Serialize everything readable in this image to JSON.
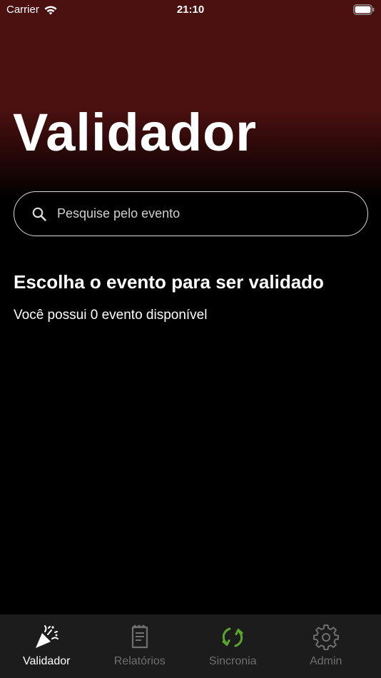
{
  "status_bar": {
    "carrier": "Carrier",
    "time": "21:10"
  },
  "header": {
    "title": "Validador"
  },
  "search": {
    "placeholder": "Pesquise pelo evento",
    "value": ""
  },
  "main": {
    "heading": "Escolha o evento para ser validado",
    "subtitle": "Você possui 0 evento disponível"
  },
  "tab_bar": {
    "tabs": [
      {
        "label": "Validador",
        "icon": "party-popper-icon",
        "active": true
      },
      {
        "label": "Relatórios",
        "icon": "receipt-icon",
        "active": false
      },
      {
        "label": "Sincronia",
        "icon": "sync-icon",
        "active": false
      },
      {
        "label": "Admin",
        "icon": "gear-icon",
        "active": false
      }
    ]
  },
  "colors": {
    "header_top": "#4b1010",
    "background": "#000000",
    "tab_bar": "#1c1c1c",
    "sync_accent": "#5aa728",
    "inactive_tab": "#6f6f6f"
  }
}
